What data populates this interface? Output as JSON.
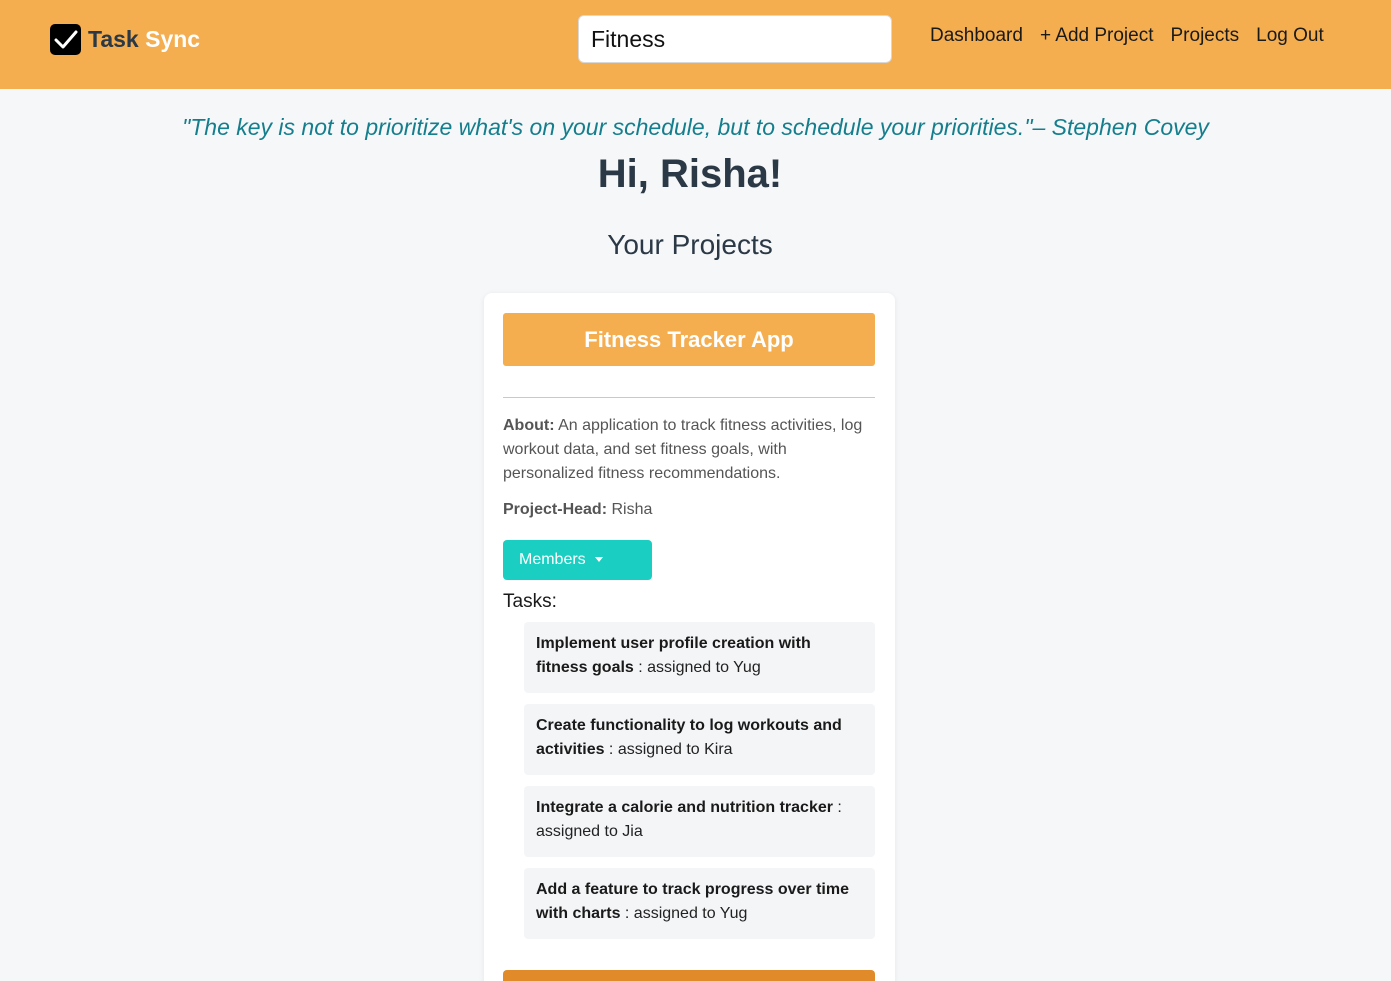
{
  "navbar": {
    "brand_task": "Task",
    "brand_sync": "Sync",
    "search": {
      "value": "Fitness",
      "placeholder": ""
    },
    "links": [
      "Dashboard",
      "+ Add Project",
      "Projects",
      "Log Out"
    ]
  },
  "quote": "\"The key is not to prioritize what's on your schedule, but to schedule your priorities.\"– Stephen Covey",
  "greeting": "Hi, Risha!",
  "section_title": "Your Projects",
  "project": {
    "title": "Fitness Tracker App",
    "about_label": "About:",
    "about_text": " An application to track fitness activities, log workout data, and set fitness goals, with personalized fitness recommendations.",
    "head_label": "Project-Head:",
    "head_value": " Risha",
    "members_label": "Members",
    "tasks_label": "Tasks:",
    "tasks": [
      {
        "title": "Implement user profile creation with fitness goals",
        "assignment": " : assigned to Yug"
      },
      {
        "title": "Create functionality to log workouts and activities",
        "assignment": " : assigned to Kira"
      },
      {
        "title": "Integrate a calorie and nutrition tracker",
        "assignment": " : assigned to Jia"
      },
      {
        "title": "Add a feature to track progress over time with charts",
        "assignment": " : assigned to Yug"
      }
    ]
  },
  "colors": {
    "navbar": "#f4ae50",
    "accent_teal": "#1acfc2",
    "quote": "#157e8d",
    "footer_bar": "#e08a2a"
  }
}
